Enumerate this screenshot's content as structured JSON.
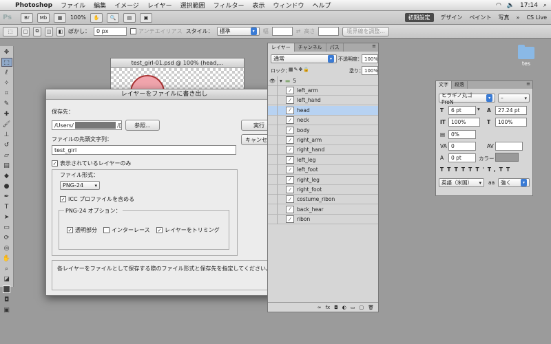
{
  "menubar": {
    "app": "Photoshop",
    "items": [
      "ファイル",
      "編集",
      "イメージ",
      "レイヤー",
      "選択範囲",
      "フィルター",
      "表示",
      "ウィンドウ",
      "ヘルプ"
    ],
    "time": "17:14",
    "workspaces": [
      "初期設定",
      "デザイン",
      "ペイント",
      "写真"
    ],
    "cs_live": "CS Live"
  },
  "appbar": {
    "logo": "Ps",
    "zoom": "100%",
    "br": "Br",
    "mb": "Mb"
  },
  "options": {
    "feather_label": "ぼかし：",
    "feather_value": "0 px",
    "antialias": "アンチエイリアス",
    "style_label": "スタイル：",
    "style_value": "標準",
    "width_label": "幅",
    "height_label": "高さ",
    "refine_edge": "境界線を調整..."
  },
  "document": {
    "title": "test_girl-01.psd @ 100% (head,..."
  },
  "dialog": {
    "title": "レイヤーをファイルに書き出し",
    "dest_label": "保存先：",
    "dest_value_prefix": "/Users/",
    "dest_value_suffix": "/[",
    "browse": "参照...",
    "run": "実行",
    "cancel": "キャンセル",
    "prefix_label": "ファイルの先頭文字列：",
    "prefix_value": "test_girl",
    "visible_only": "表示されているレイヤーのみ",
    "file_type_label": "ファイル形式：",
    "file_type_value": "PNG-24",
    "icc": "ICC プロファイルを含める",
    "png_options_label": "PNG-24 オプション：",
    "transparency": "透明部分",
    "interlace": "インターレース",
    "trim": "レイヤーをトリミング",
    "description": "各レイヤーをファイルとして保存する際のファイル形式と保存先を指定してください。"
  },
  "layers_panel": {
    "tabs": [
      "レイヤー",
      "チャンネル",
      "パス"
    ],
    "blend_mode": "通常",
    "opacity_label": "不透明度：",
    "opacity_value": "100%",
    "lock_label": "ロック：",
    "fill_label": "塗り：",
    "fill_value": "100%",
    "group_name": "5",
    "layers": [
      "left_arm",
      "left_hand",
      "head",
      "neck",
      "body",
      "right_arm",
      "right_hand",
      "left_leg",
      "left_foot",
      "right_leg",
      "right_foot",
      "costume_ribon",
      "back_hear",
      "ribon"
    ],
    "active_layer": "head"
  },
  "char_panel": {
    "tabs": [
      "文字",
      "段落"
    ],
    "font": "ヒラギノ丸ゴ ProN",
    "font_style": "–",
    "size": "6 pt",
    "leading": "27.24 pt",
    "vscale": "100%",
    "hscale": "100%",
    "tsume": "0%",
    "tracking": "0",
    "baseline": "0 pt",
    "color_label": "カラー：",
    "language": "英語（米国）",
    "aa_label": "aa",
    "aa_value": "強く"
  },
  "desktop": {
    "folder_label": "tes"
  }
}
